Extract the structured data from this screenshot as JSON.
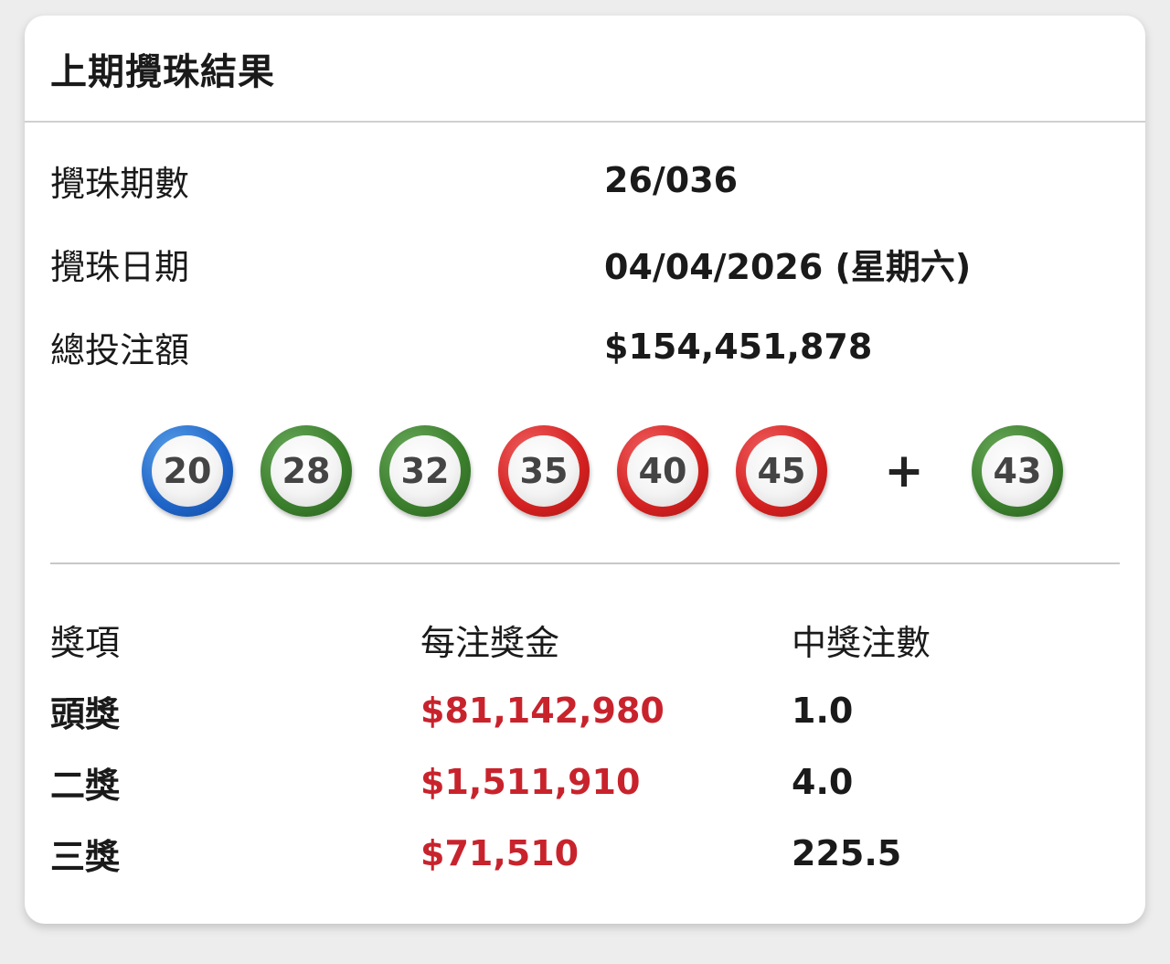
{
  "card": {
    "title": "上期攪珠結果"
  },
  "info": [
    {
      "label": "攪珠期數",
      "value": "26/036"
    },
    {
      "label": "攪珠日期",
      "value": "04/04/2026 (星期六)"
    },
    {
      "label": "總投注額",
      "value": "$154,451,878"
    }
  ],
  "balls": [
    {
      "number": "20",
      "color": "blue"
    },
    {
      "number": "28",
      "color": "green"
    },
    {
      "number": "32",
      "color": "green"
    },
    {
      "number": "35",
      "color": "red"
    },
    {
      "number": "40",
      "color": "red"
    },
    {
      "number": "45",
      "color": "red"
    }
  ],
  "plus_sign": "+",
  "extra_ball": {
    "number": "43",
    "color": "green"
  },
  "prizes": {
    "headers": [
      "獎項",
      "每注獎金",
      "中獎注數"
    ],
    "rows": [
      {
        "name": "頭獎",
        "amount": "$81,142,980",
        "count": "1.0"
      },
      {
        "name": "二獎",
        "amount": "$1,511,910",
        "count": "4.0"
      },
      {
        "name": "三獎",
        "amount": "$71,510",
        "count": "225.5"
      }
    ]
  },
  "colors": {
    "prize_amount": "#c8232c",
    "ball_blue": "#1e64c8",
    "ball_green": "#3a7e2c",
    "ball_red": "#d42020"
  }
}
